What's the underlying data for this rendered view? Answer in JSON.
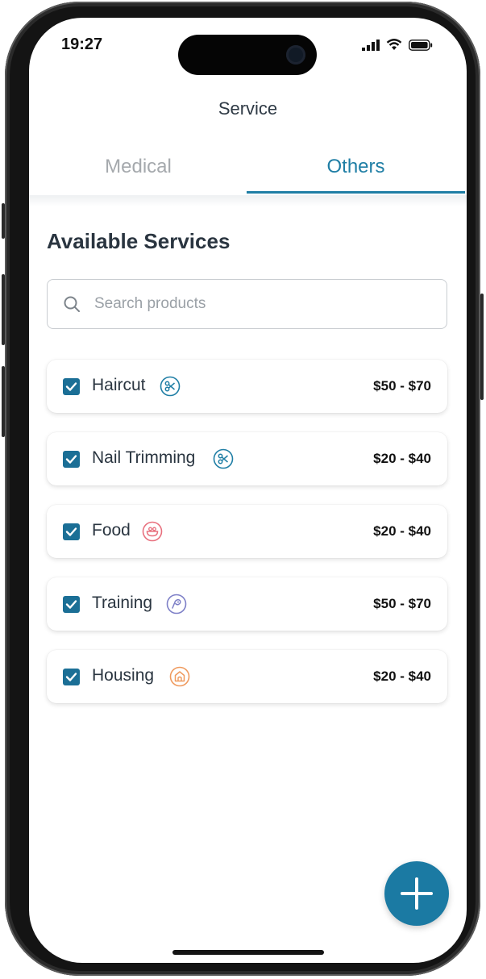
{
  "status_bar": {
    "time": "19:27"
  },
  "header": {
    "title": "Service"
  },
  "tabs": [
    {
      "label": "Medical",
      "active": false
    },
    {
      "label": "Others",
      "active": true
    }
  ],
  "section": {
    "title": "Available Services"
  },
  "search": {
    "placeholder": "Search products",
    "value": ""
  },
  "services": [
    {
      "name": "Haircut",
      "price": "$50 - $70",
      "checked": true,
      "icon": "scissors-icon",
      "icon_color": "#1f7ea5"
    },
    {
      "name": "Nail Trimming",
      "price": "$20 - $40",
      "checked": true,
      "icon": "scissors-icon",
      "icon_color": "#1f7ea5"
    },
    {
      "name": "Food",
      "price": "$20 - $40",
      "checked": true,
      "icon": "food-bowl-icon",
      "icon_color": "#e8707e"
    },
    {
      "name": "Training",
      "price": "$50 - $70",
      "checked": true,
      "icon": "training-icon",
      "icon_color": "#7d7fc7"
    },
    {
      "name": "Housing",
      "price": "$20 - $40",
      "checked": true,
      "icon": "house-icon",
      "icon_color": "#ef9a5e"
    }
  ],
  "colors": {
    "accent": "#1f7ea5",
    "checkbox": "#1b6f96",
    "fab": "#1b7aa3"
  },
  "fab": {
    "icon": "plus-icon"
  }
}
